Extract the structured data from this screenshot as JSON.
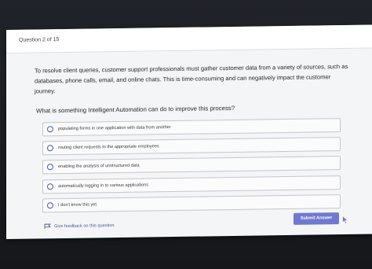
{
  "header": {
    "question_number": "Question 2 of 15"
  },
  "prompt": "To resolve client queries, customer support professionals must gather customer data from a variety of sources, such as databases, phone calls, email, and online chats. This is time-consuming and can negatively impact the customer journey.",
  "question": "What is something Intelligent Automation can do to improve this process?",
  "options": [
    {
      "label": "populating forms in one application with data from another"
    },
    {
      "label": "routing client requests to the appropriate employees"
    },
    {
      "label": "enabling the analysis of unstructured data"
    },
    {
      "label": "automatically logging in to various applications"
    },
    {
      "label": "I don't know this yet."
    }
  ],
  "actions": {
    "submit_label": "Submit Answer",
    "feedback_label": "Give feedback on this question"
  },
  "icons": {
    "feedback": "feedback-flag-icon",
    "cursor": "mouse-pointer-icon"
  },
  "colors": {
    "accent": "#6f79cf",
    "radio": "#3f55b8"
  }
}
